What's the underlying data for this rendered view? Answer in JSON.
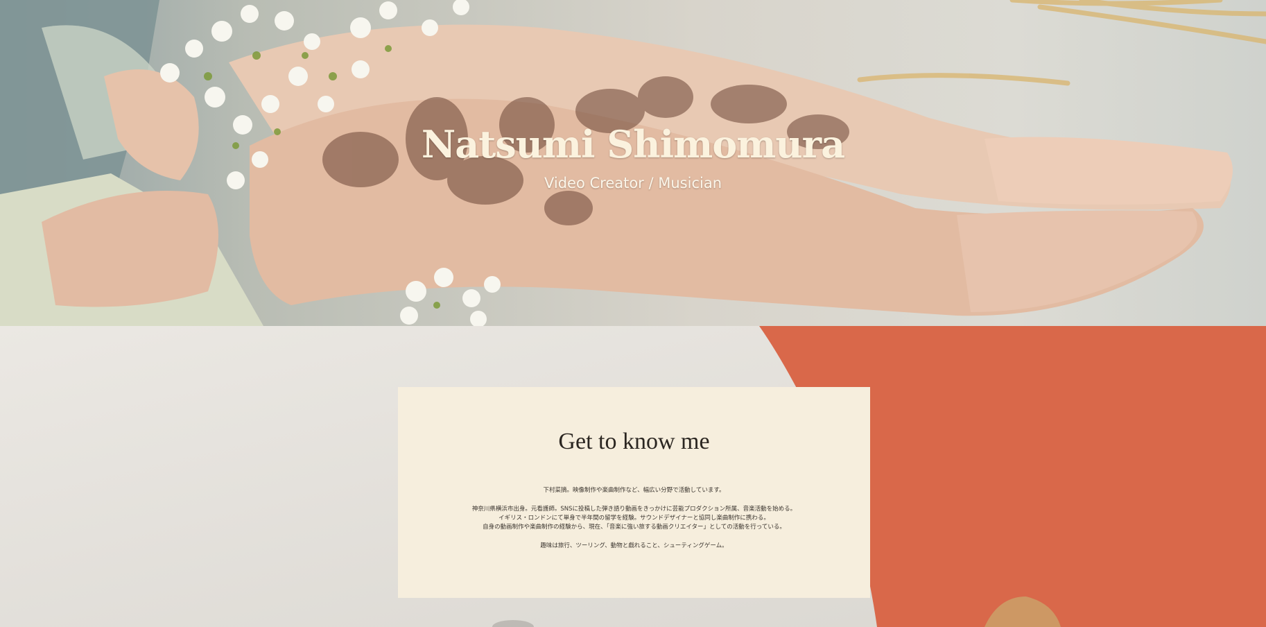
{
  "hero": {
    "title": "Natsumi Shimomura",
    "subtitle": "Video Creator / Musician"
  },
  "about": {
    "heading": "Get to know me",
    "paragraph1": "下村菜摘。映像制作や楽曲制作など、幅広い分野で活動しています。",
    "paragraph2": [
      "神奈川県横浜市出身。元看護師。SNSに投稿した弾き語り動画をきっかけに芸能プロダクション所属、音楽活動を始める。",
      "イギリス・ロンドンにて単身で半年間の留学を経験。サウンドデザイナーと協同し楽曲制作に携わる。",
      "自身の動画制作や楽曲制作の経験から、現在、「音楽に強い旅する動画クリエイター」としての活動を行っている。"
    ],
    "paragraph3": "趣味は旅行、ツーリング、動物と戯れること、シューティングゲーム。"
  },
  "colors": {
    "accent_orange": "#d9684a",
    "card_background": "#f6eedd",
    "hero_text": "#fbf2de"
  }
}
